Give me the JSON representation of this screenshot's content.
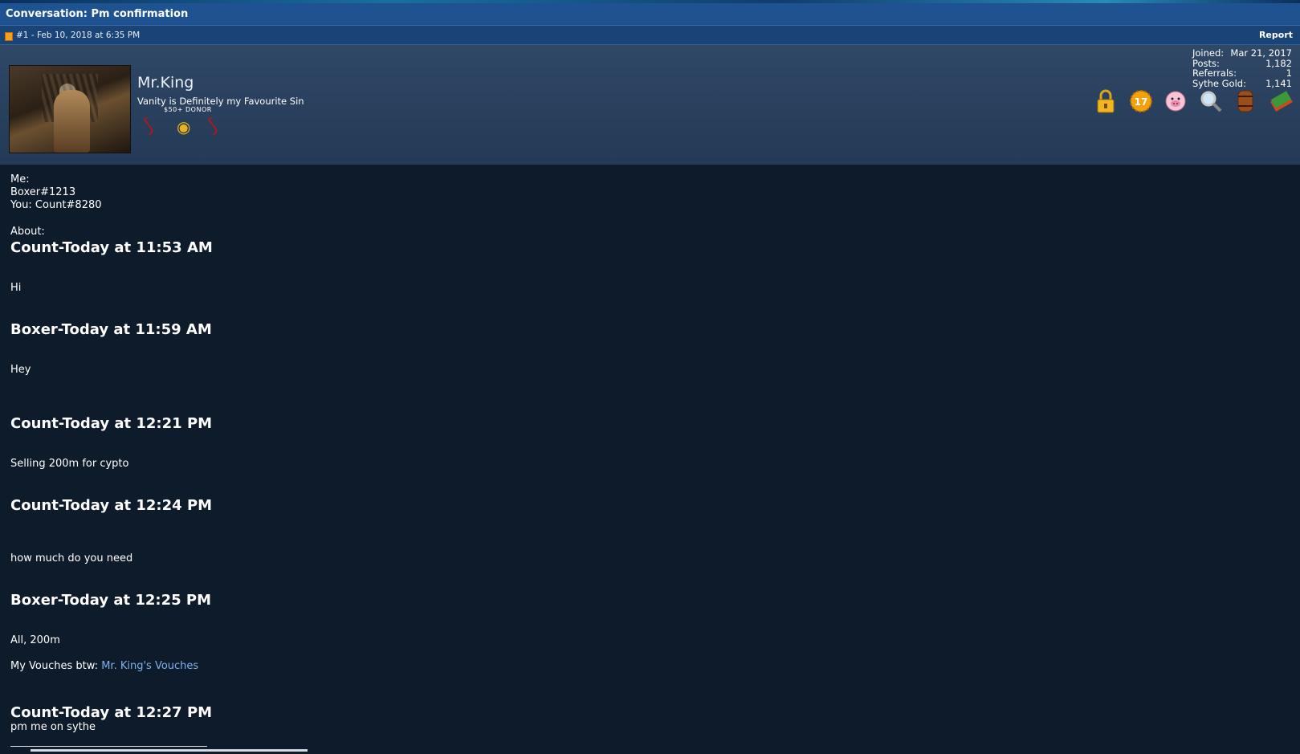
{
  "header": {
    "title": "Conversation: Pm confirmation"
  },
  "post": {
    "meta": "#1 - Feb 10, 2018 at 6:35 PM",
    "report_label": "Report"
  },
  "user": {
    "name": "Mr.King",
    "tagline": "Vanity is Definitely my Favourite Sin",
    "donor_label": "$50+ DONOR",
    "stats": [
      {
        "label": "Joined:",
        "value": "Mar 21, 2017"
      },
      {
        "label": "Posts:",
        "value": "1,182"
      },
      {
        "label": "Referrals:",
        "value": "1"
      },
      {
        "label": "Sythe Gold:",
        "value": "1,141"
      }
    ],
    "awards": [
      "lock-icon",
      "badge-17-icon",
      "pig-icon",
      "magnifier-icon",
      "barrel-icon",
      "cash-icon"
    ],
    "award_badge_number": "17"
  },
  "body": {
    "me_label": "Me:",
    "me_value": "Boxer#1213",
    "you_line": "You: Count#8280",
    "about_label": "About:",
    "messages": [
      {
        "header": "Count-Today at 11:53 AM",
        "text": "Hi"
      },
      {
        "header": "Boxer-Today at 11:59 AM",
        "text": "Hey"
      },
      {
        "header": "Count-Today at 12:21 PM",
        "text": "Selling 200m for cypto"
      },
      {
        "header": "Count-Today at 12:24 PM",
        "text": "how much do you need"
      },
      {
        "header": "Boxer-Today at 12:25 PM",
        "text": "All, 200m"
      },
      {
        "header": "Count-Today at 12:27 PM",
        "text": "pm me on sythe"
      }
    ],
    "vouch_prefix": "My Vouches btw: ",
    "vouch_link": "Mr. King's Vouches"
  },
  "colors": {
    "page_bg": "#0e1b2b",
    "titlebar": "#1f5290",
    "userbar": "#2f4866",
    "link": "#7fb2ea"
  }
}
